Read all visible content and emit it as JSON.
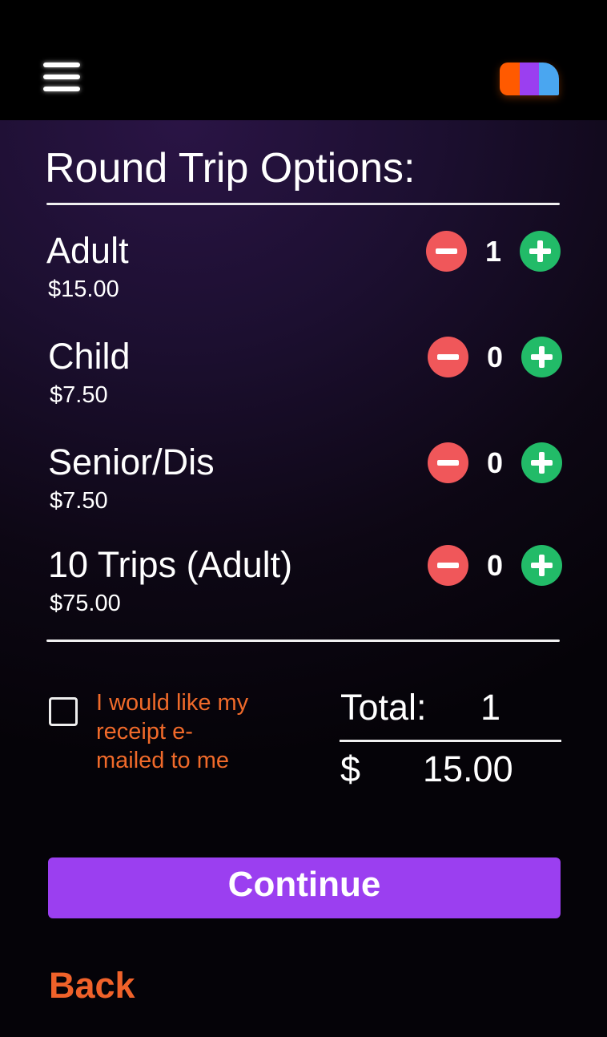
{
  "header": {
    "menu_icon": "hamburger-icon",
    "logo_colors": [
      "#ff5a00",
      "#9b3ff0",
      "#4aa6f0"
    ]
  },
  "section_title": "Round Trip Options:",
  "tickets": [
    {
      "name": "Adult",
      "price": "$15.00",
      "quantity": "1"
    },
    {
      "name": "Child",
      "price": "$7.50",
      "quantity": "0"
    },
    {
      "name": "Senior/Dis",
      "price": "$7.50",
      "quantity": "0"
    },
    {
      "name": "10 Trips (Adult)",
      "price": "$75.00",
      "quantity": "0"
    }
  ],
  "receipt": {
    "label": "I would like my receipt e-mailed to me",
    "checked": false
  },
  "total": {
    "label": "Total:",
    "count": "1",
    "currency": "$",
    "amount": "15.00"
  },
  "buttons": {
    "continue": "Continue",
    "back": "Back"
  },
  "colors": {
    "minus": "#f0575a",
    "plus": "#22bb68",
    "accent": "#9b3ff0",
    "link": "#f0622a"
  }
}
